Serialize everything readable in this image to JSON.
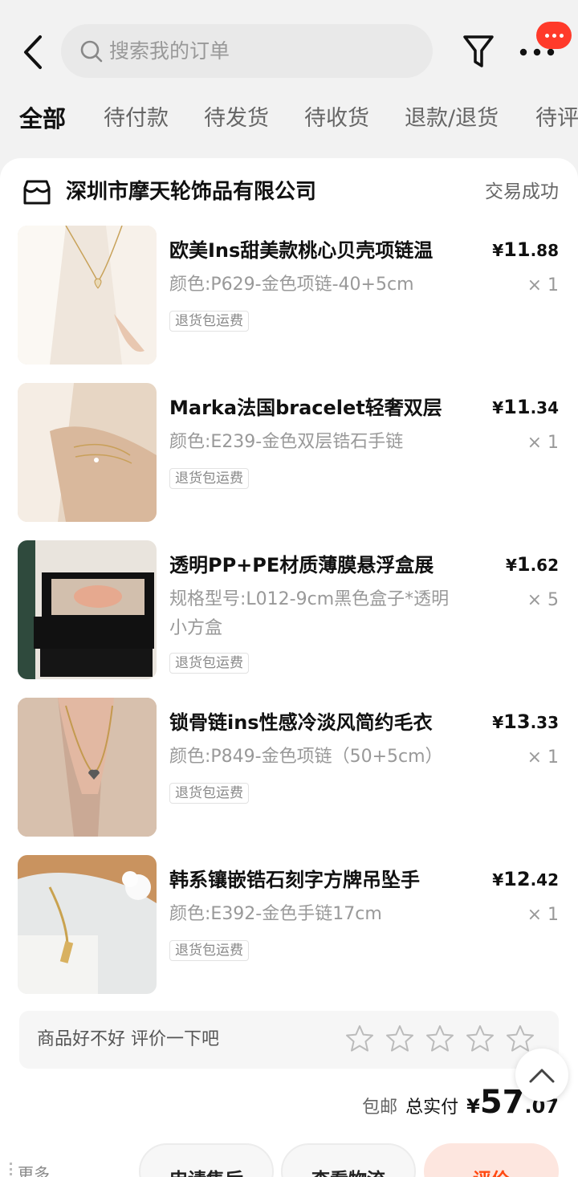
{
  "header": {
    "search_placeholder": "搜索我的订单"
  },
  "tabs": [
    "全部",
    "待付款",
    "待发货",
    "待收货",
    "退款/退货",
    "待评"
  ],
  "shop": {
    "name": "深圳市摩天轮饰品有限公司",
    "status": "交易成功"
  },
  "items": [
    {
      "title": "欧美Ins甜美款桃心贝壳项链温",
      "spec": "颜色:P629-金色项链-40+5cm",
      "price_int": "11",
      "price_dec": ".88",
      "qty": "× 1",
      "tag": "退货包运费"
    },
    {
      "title": "Marka法国bracelet轻奢双层",
      "spec": "颜色:E239-金色双层锆石手链",
      "price_int": "11",
      "price_dec": ".34",
      "qty": "× 1",
      "tag": "退货包运费"
    },
    {
      "title": "透明PP+PE材质薄膜悬浮盒展",
      "spec": "规格型号:L012-9cm黑色盒子*透明小方盒",
      "price_int": "1",
      "price_dec": ".62",
      "qty": "× 5",
      "tag": "退货包运费"
    },
    {
      "title": "锁骨链ins性感冷淡风简约毛衣",
      "spec": "颜色:P849-金色项链（50+5cm）",
      "price_int": "13",
      "price_dec": ".33",
      "qty": "× 1",
      "tag": "退货包运费"
    },
    {
      "title": "韩系镶嵌锆石刻字方牌吊坠手",
      "spec": "颜色:E392-金色手链17cm",
      "price_int": "12",
      "price_dec": ".42",
      "qty": "× 1",
      "tag": "退货包运费"
    }
  ],
  "currency": "¥",
  "review": {
    "prompt": "商品好不好 评价一下吧",
    "star_count": 5
  },
  "total": {
    "shipping": "包邮",
    "label": "总实付",
    "currency": "¥",
    "int": "57",
    "dec": ".07"
  },
  "actions": {
    "more": "更多",
    "after_sales": "申请售后",
    "logistics": "查看物流",
    "review": "评价"
  }
}
